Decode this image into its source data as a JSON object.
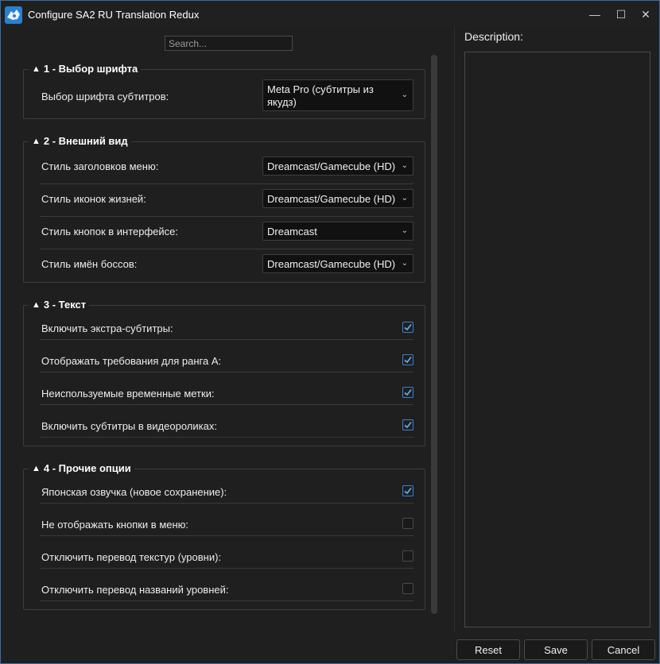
{
  "window": {
    "title": "Configure SA2 RU Translation Redux",
    "minimize_glyph": "—",
    "maximize_glyph": "☐",
    "close_glyph": "✕"
  },
  "search": {
    "placeholder": "Search..."
  },
  "groups": [
    {
      "title": "1 - Выбор шрифта",
      "rows": [
        {
          "label": "Выбор шрифта субтитров:",
          "type": "combo",
          "value": "Meta Pro (субтитры из якудз)"
        }
      ]
    },
    {
      "title": "2 - Внешний вид",
      "rows": [
        {
          "label": "Стиль заголовков меню:",
          "type": "combo",
          "value": "Dreamcast/Gamecube (HD)"
        },
        {
          "label": "Стиль иконок жизней:",
          "type": "combo",
          "value": "Dreamcast/Gamecube (HD)"
        },
        {
          "label": "Стиль кнопок в интерфейсе:",
          "type": "combo",
          "value": "Dreamcast"
        },
        {
          "label": "Стиль имён боссов:",
          "type": "combo",
          "value": "Dreamcast/Gamecube (HD)"
        }
      ]
    },
    {
      "title": "3 - Текст",
      "rows": [
        {
          "label": "Включить экстра-субтитры:",
          "type": "check",
          "checked": true
        },
        {
          "label": "Отображать требования для ранга А:",
          "type": "check",
          "checked": true
        },
        {
          "label": "Неиспользуемые временные метки:",
          "type": "check",
          "checked": true
        },
        {
          "label": "Включить субтитры в видеороликах:",
          "type": "check",
          "checked": true
        }
      ]
    },
    {
      "title": "4 - Прочие опции",
      "rows": [
        {
          "label": "Японская озвучка (новое сохранение):",
          "type": "check",
          "checked": true
        },
        {
          "label": "Не отображать кнопки в меню:",
          "type": "check",
          "checked": false
        },
        {
          "label": "Отключить перевод текстур (уровни):",
          "type": "check",
          "checked": false
        },
        {
          "label": "Отключить перевод названий уровней:",
          "type": "check",
          "checked": false
        }
      ]
    }
  ],
  "collapse_glyph": "▲",
  "dropdown_glyph": "⌄",
  "description": {
    "label": "Description:"
  },
  "buttons": {
    "reset": "Reset",
    "save": "Save",
    "cancel": "Cancel"
  },
  "colors": {
    "accent": "#3c80c8",
    "window_border": "#3a6ea5",
    "background": "#1f1f1f"
  }
}
